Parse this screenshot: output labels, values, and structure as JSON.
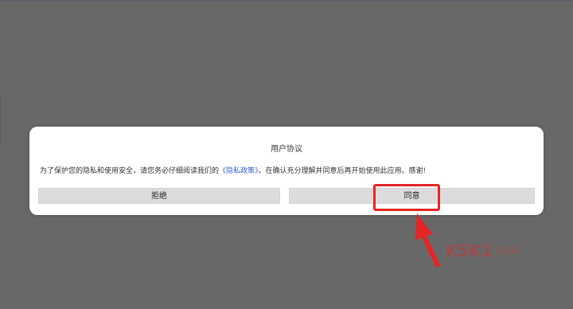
{
  "dialog": {
    "title": "用户协议",
    "message_before": "为了保护您的隐私和使用安全，请您务必仔细阅读我们的",
    "policy_link": "《隐私政策》",
    "message_after": "。在确认充分理解并同意后再开始使用此应用。感谢!",
    "reject_label": "拒绝",
    "agree_label": "同意"
  },
  "annotation": {
    "color": "#e42525"
  },
  "watermark": {
    "brand": "K5K1",
    "suffix": "手游网"
  }
}
